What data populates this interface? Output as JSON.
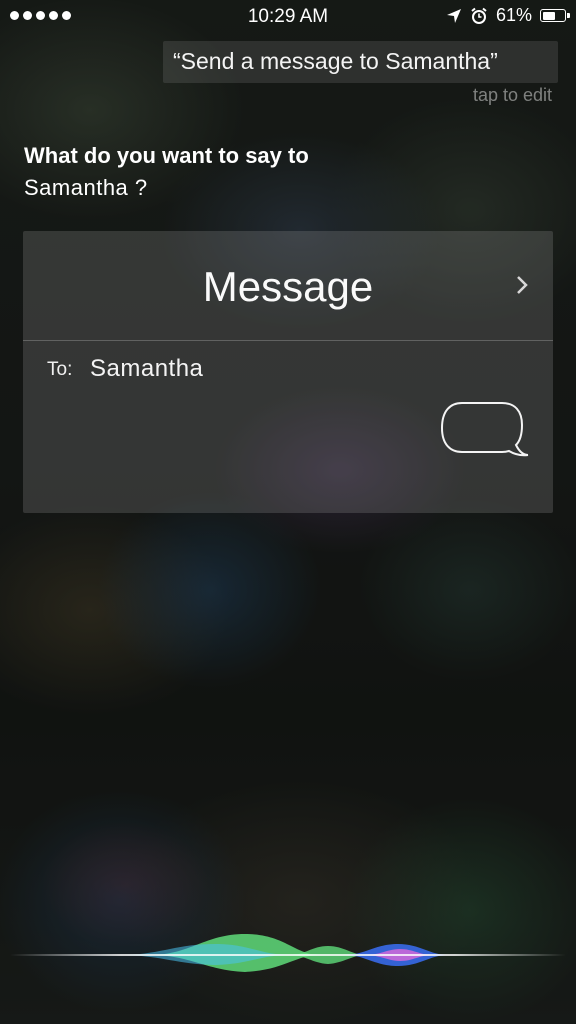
{
  "status_bar": {
    "signal_dots": 5,
    "time": "10:29 AM",
    "icons": [
      "location-arrow-icon",
      "alarm-clock-icon"
    ],
    "battery_text": "61%",
    "battery_level": 0.61
  },
  "query": {
    "text": "“Send a message to Samantha”",
    "hint": "tap to edit"
  },
  "response": {
    "line1": "What do you want to say to",
    "line2": "Samantha ?"
  },
  "card": {
    "title": "Message",
    "to_label": "To:",
    "recipient": "Samantha",
    "icon": "message-bubble-icon"
  },
  "waveform": {
    "colors": [
      "#5fdc7a",
      "#49c2f0",
      "#3a6ef5",
      "#e86ad9"
    ]
  }
}
